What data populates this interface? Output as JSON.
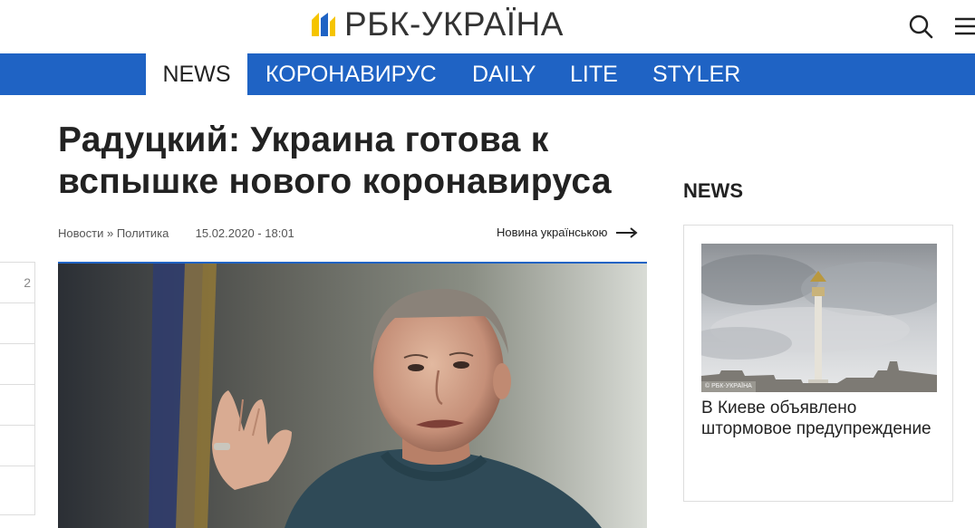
{
  "header": {
    "logo_text": "РБК-УКРАЇНА",
    "search_icon": "search-icon",
    "menu_icon": "menu-icon"
  },
  "nav": {
    "items": [
      "NEWS",
      "КОРОНАВИРУС",
      "DAILY",
      "LITE",
      "STYLER"
    ],
    "active": "NEWS"
  },
  "article": {
    "title_line1": "Радуцкий: Украина готова к",
    "title_line2": "вспышке нового коронавируса",
    "breadcrumb_news": "Новости",
    "breadcrumb_sep": "»",
    "breadcrumb_section": "Политика",
    "date": "15.02.2020 - 18:01",
    "lang_link": "Новина українською"
  },
  "share": {
    "cells": [
      "2",
      "",
      "",
      "",
      "",
      ""
    ]
  },
  "sidebar": {
    "heading": "NEWS",
    "card_caption": "В Киеве объявлено штормовое предупреждение",
    "watermark": "© РБК-УКРАЇНА"
  },
  "colors": {
    "brand_blue": "#1f63c4",
    "logo_yellow": "#f5c400"
  }
}
